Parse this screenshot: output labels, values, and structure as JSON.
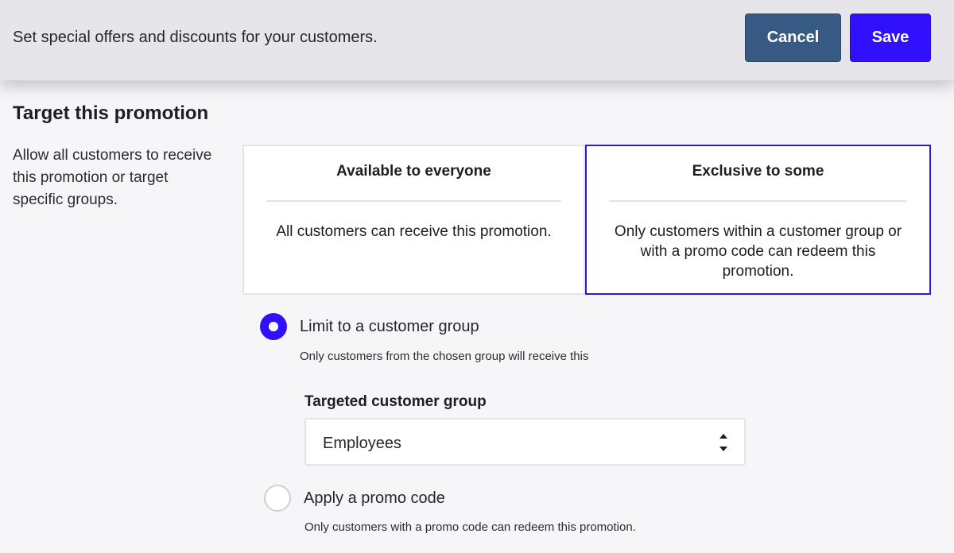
{
  "header": {
    "description": "Set special offers and discounts for your customers.",
    "cancel_label": "Cancel",
    "save_label": "Save"
  },
  "section": {
    "title": "Target this promotion",
    "help": "Allow all customers to receive this promotion or target specific groups."
  },
  "audience_options": [
    {
      "title": "Available to everyone",
      "description": "All customers can receive this promotion.",
      "selected": false
    },
    {
      "title": "Exclusive to some",
      "description": "Only customers within a customer group or with a promo code can redeem this promotion.",
      "selected": true
    }
  ],
  "exclusive_methods": {
    "customer_group": {
      "label": "Limit to a customer group",
      "help": "Only customers from the chosen group will receive this",
      "checked": true
    },
    "promo_code": {
      "label": "Apply a promo code",
      "help": "Only customers with a promo code can redeem this promotion.",
      "checked": false
    }
  },
  "customer_group_field": {
    "label": "Targeted customer group",
    "value": "Employees"
  },
  "colors": {
    "primary": "#3010ff",
    "cancel": "#365a84",
    "selected_border": "#2c1ecc"
  }
}
